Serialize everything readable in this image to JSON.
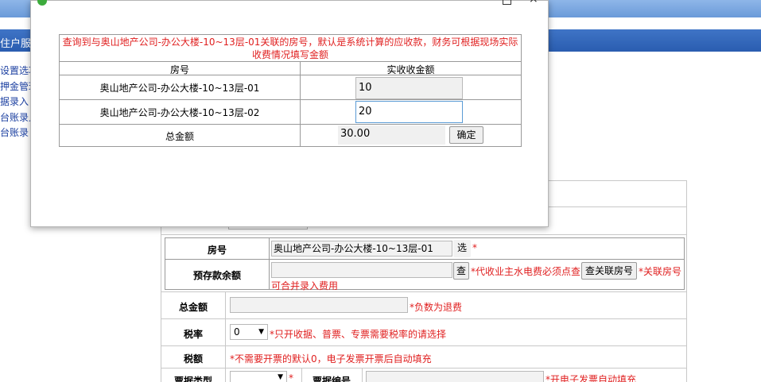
{
  "dialog": {
    "notice": "查询到与奥山地产公司-办公大楼-10~13层-01关联的房号，默认是系统计算的应收款，财务可根据现场实际收费情况填写金额",
    "headers": {
      "room": "房号",
      "amount": "实收收金额"
    },
    "rows": [
      {
        "room": "奥山地产公司-办公大楼-10~13层-01",
        "amount": "10"
      },
      {
        "room": "奥山地产公司-办公大楼-10~13层-02",
        "amount": "20"
      }
    ],
    "total_label": "总金额",
    "total_value": "30.00",
    "confirm_label": "确定",
    "close_glyph": "×"
  },
  "background": {
    "nav_title": "住户服",
    "side_items": [
      "设置选项",
      "押金管理",
      "据录入",
      "台账录入",
      "台账录"
    ],
    "form": {
      "room_label": "房号",
      "room_value": "奥山地产公司-办公大楼-10~13层-01",
      "select_btn": "选",
      "asterisk": "*",
      "balance_label": "预存款余额",
      "query_btn": "查",
      "balance_note": "*代收业主水电费必须点查",
      "related_btn": "查关联房号",
      "related_note": "*关联房号",
      "related_note2": "可合并录入费用",
      "total_label": "总金额",
      "total_note": "*负数为退费",
      "tax_label": "税率",
      "tax_value": "0",
      "tax_note": "*只开收据、普票、专票需要税率的请选择",
      "taxamt_label": "税额",
      "taxamt_note": "*不需要开票的默认0，电子发票开票后自动填充",
      "ticket_type_label": "票据类型",
      "ticket_no_label": "票据编号",
      "ticket_no_note": "*开电子发票自动填充"
    }
  },
  "colors": {
    "accent_blue": "#2a5db0",
    "warning_red": "#e02020",
    "focus_border": "#5b9bd5"
  }
}
